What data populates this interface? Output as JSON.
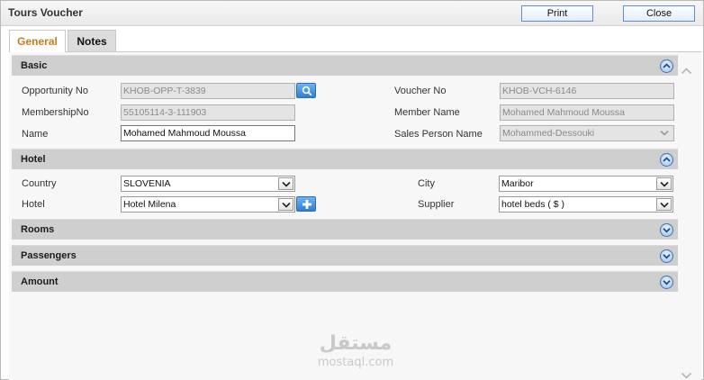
{
  "window": {
    "title": "Tours Voucher",
    "print_label": "Print",
    "close_label": "Close"
  },
  "tabs": [
    {
      "label": "General",
      "active": true
    },
    {
      "label": "Notes",
      "active": false
    }
  ],
  "colors": {
    "active_tab": "#d07a1a",
    "section_bar": "#cfcfcf",
    "accent": "#2f7ed8"
  },
  "basic": {
    "title": "Basic",
    "opportunity_no": {
      "label": "Opportunity No",
      "value": "KHOB-OPP-T-3839"
    },
    "voucher_no": {
      "label": "Voucher No",
      "value": "KHOB-VCH-6146"
    },
    "membership_no": {
      "label": "MembershipNo",
      "value": "55105114-3-111903"
    },
    "member_name": {
      "label": "Member Name",
      "value": "Mohamed Mahmoud Moussa"
    },
    "name": {
      "label": "Name",
      "value": "Mohamed Mahmoud Moussa"
    },
    "sales_person": {
      "label": "Sales Person Name",
      "value": "Mohammed-Dessouki"
    }
  },
  "hotel": {
    "title": "Hotel",
    "country": {
      "label": "Country",
      "value": "SLOVENIA"
    },
    "city": {
      "label": "City",
      "value": "Maribor"
    },
    "hotel": {
      "label": "Hotel",
      "value": "Hotel Milena"
    },
    "supplier": {
      "label": "Supplier",
      "value": "hotel beds ( $ )"
    }
  },
  "sections": {
    "rooms": "Rooms",
    "passengers": "Passengers",
    "amount": "Amount"
  },
  "icons": {
    "search": "search-icon",
    "add": "plus-icon",
    "collapse": "chevron-up-icon",
    "expand": "chevron-down-icon"
  },
  "watermark": {
    "arabic": "مستقل",
    "latin": "mostaql.com"
  }
}
